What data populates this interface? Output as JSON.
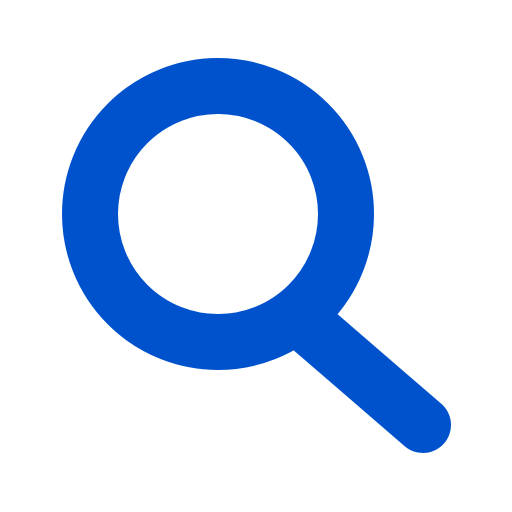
{
  "icon": {
    "name": "search-icon",
    "color": "#0052CC",
    "background": "#FFFFFF"
  }
}
